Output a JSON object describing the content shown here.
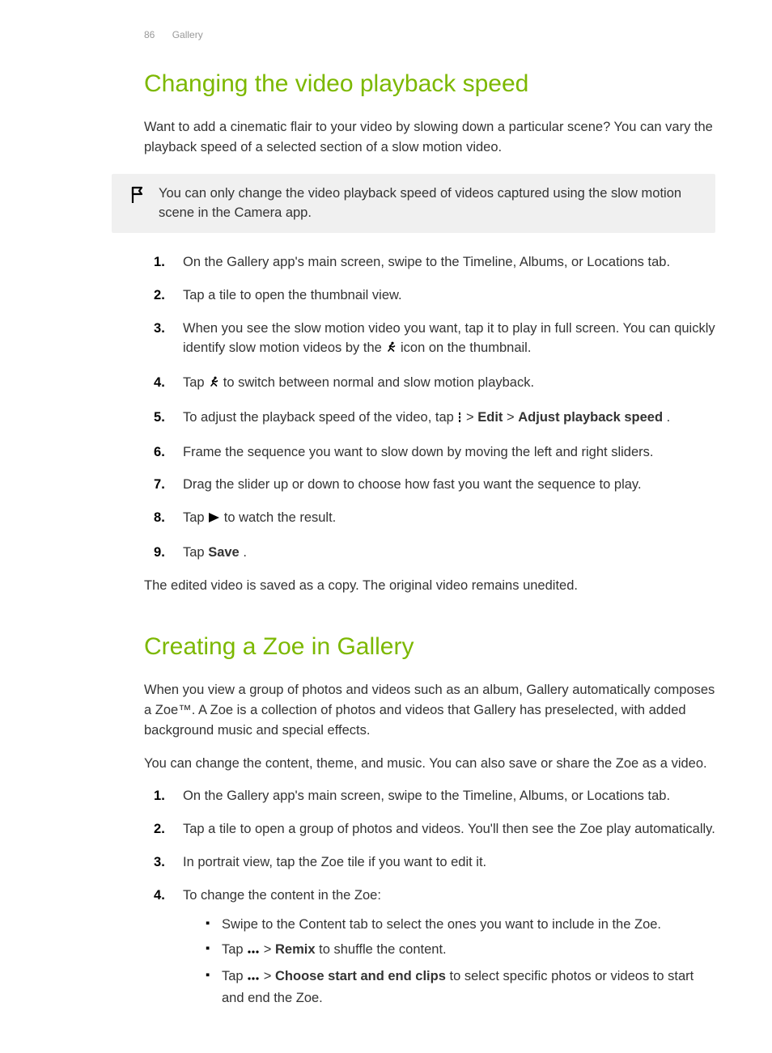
{
  "header": {
    "page_number": "86",
    "section": "Gallery"
  },
  "section1": {
    "title": "Changing the video playback speed",
    "intro": "Want to add a cinematic flair to your video by slowing down a particular scene? You can vary the playback speed of a selected section of a slow motion video.",
    "note": "You can only change the video playback speed of videos captured using the slow motion scene in the Camera app.",
    "steps": {
      "s1": "On the Gallery app's main screen, swipe to the Timeline, Albums, or Locations tab.",
      "s2": "Tap a tile to open the thumbnail view.",
      "s3a": "When you see the slow motion video you want, tap it to play in full screen. You can quickly identify slow motion videos by the ",
      "s3b": " icon on the thumbnail.",
      "s4a": "Tap ",
      "s4b": " to switch between normal and slow motion playback.",
      "s5a": "To adjust the playback speed of the video, tap ",
      "s5b": " > ",
      "s5_edit": "Edit",
      "s5c": " > ",
      "s5_adjust": "Adjust playback speed",
      "s5d": ".",
      "s6": "Frame the sequence you want to slow down by moving the left and right sliders.",
      "s7": "Drag the slider up or down to choose how fast you want the sequence to play.",
      "s8a": "Tap ",
      "s8b": " to watch the result.",
      "s9a": "Tap ",
      "s9_save": "Save",
      "s9b": "."
    },
    "outro": "The edited video is saved as a copy. The original video remains unedited."
  },
  "section2": {
    "title": "Creating a Zoe in Gallery",
    "para1": "When you view a group of photos and videos such as an album, Gallery automatically composes a Zoe™. A Zoe is a collection of photos and videos that Gallery has preselected, with added background music and special effects.",
    "para2": "You can change the content, theme, and music. You can also save or share the Zoe as a video.",
    "steps": {
      "s1": "On the Gallery app's main screen, swipe to the Timeline, Albums, or Locations tab.",
      "s2": "Tap a tile to open a group of photos and videos. You'll then see the Zoe play automatically.",
      "s3": "In portrait view, tap the Zoe tile if you want to edit it.",
      "s4": "To change the content in the Zoe:",
      "s4_b1": "Swipe to the Content tab to select the ones you want to include in the Zoe.",
      "s4_b2a": "Tap ",
      "s4_b2b": " > ",
      "s4_b2_remix": "Remix",
      "s4_b2c": " to shuffle the content.",
      "s4_b3a": "Tap ",
      "s4_b3b": " > ",
      "s4_b3_choose": "Choose start and end clips",
      "s4_b3c": " to select specific photos or videos to start and end the Zoe."
    }
  }
}
